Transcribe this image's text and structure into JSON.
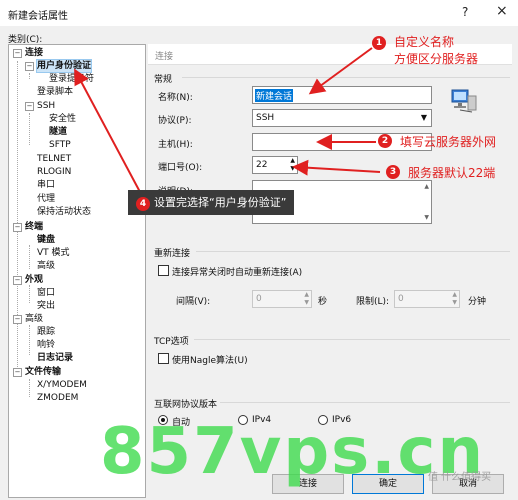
{
  "window": {
    "title": "新建会话属性",
    "help": "?",
    "close": "×"
  },
  "category_label": "类别(C):",
  "tree": [
    {
      "label": "连接",
      "bold": true
    },
    {
      "label": "用户身份验证",
      "bold": true,
      "selected": true
    },
    {
      "label": "登录提示符",
      "bold": false
    },
    {
      "label": "登录脚本",
      "bold": false
    },
    {
      "label": "SSH",
      "bold": false
    },
    {
      "label": "安全性",
      "bold": false
    },
    {
      "label": "隧道",
      "bold": true
    },
    {
      "label": "SFTP",
      "bold": false
    },
    {
      "label": "TELNET",
      "bold": false
    },
    {
      "label": "RLOGIN",
      "bold": false
    },
    {
      "label": "串口",
      "bold": false
    },
    {
      "label": "代理",
      "bold": false
    },
    {
      "label": "保持活动状态",
      "bold": false
    },
    {
      "label": "终端",
      "bold": true
    },
    {
      "label": "键盘",
      "bold": true
    },
    {
      "label": "VT 模式",
      "bold": false
    },
    {
      "label": "高级",
      "bold": false
    },
    {
      "label": "外观",
      "bold": true
    },
    {
      "label": "窗口",
      "bold": false
    },
    {
      "label": "突出",
      "bold": false
    },
    {
      "label": "高级",
      "bold": false
    },
    {
      "label": "跟踪",
      "bold": false
    },
    {
      "label": "响铃",
      "bold": false
    },
    {
      "label": "日志记录",
      "bold": true
    },
    {
      "label": "文件传输",
      "bold": true
    },
    {
      "label": "X/YMODEM",
      "bold": false
    },
    {
      "label": "ZMODEM",
      "bold": false
    }
  ],
  "panel_header": "连接",
  "general": {
    "title": "常规",
    "name_label": "名称(N):",
    "name_value": "新建会话",
    "protocol_label": "协议(P):",
    "protocol_value": "SSH",
    "host_label": "主机(H):",
    "host_value": "",
    "port_label": "端口号(O):",
    "port_value": "22",
    "desc_label": "说明(D):"
  },
  "reconnect": {
    "title": "重新连接",
    "checkbox_label": "连接异常关闭时自动重新连接(A)",
    "interval_label": "间隔(V):",
    "interval_value": "0",
    "interval_unit": "秒",
    "limit_label": "限制(L):",
    "limit_value": "0",
    "limit_unit": "分钟"
  },
  "tcp": {
    "title": "TCP选项",
    "nagle_label": "使用Nagle算法(U)"
  },
  "ip": {
    "title": "互联网协议版本",
    "auto": "自动",
    "ipv4": "IPv4",
    "ipv6": "IPv6"
  },
  "buttons": {
    "connect": "连接",
    "ok": "确定",
    "cancel": "取消"
  },
  "callouts": {
    "c1_num": "1",
    "c1_line1": "自定义名称",
    "c1_line2": "方便区分服务器",
    "c2_num": "2",
    "c2_text": "填写云服务器外网",
    "c3_num": "3",
    "c3_text": "服务器默认22端",
    "c4_num": "4",
    "c4_text": "设置完选择“用户身份验证”"
  },
  "watermark": {
    "main": "857vps.cn",
    "small": "值 什么值得买"
  },
  "colors": {
    "callout": "#e02020",
    "selection": "#cce4f7",
    "watermark": "#3fdc4e"
  },
  "icons": {
    "network": "network-computer-icon"
  }
}
